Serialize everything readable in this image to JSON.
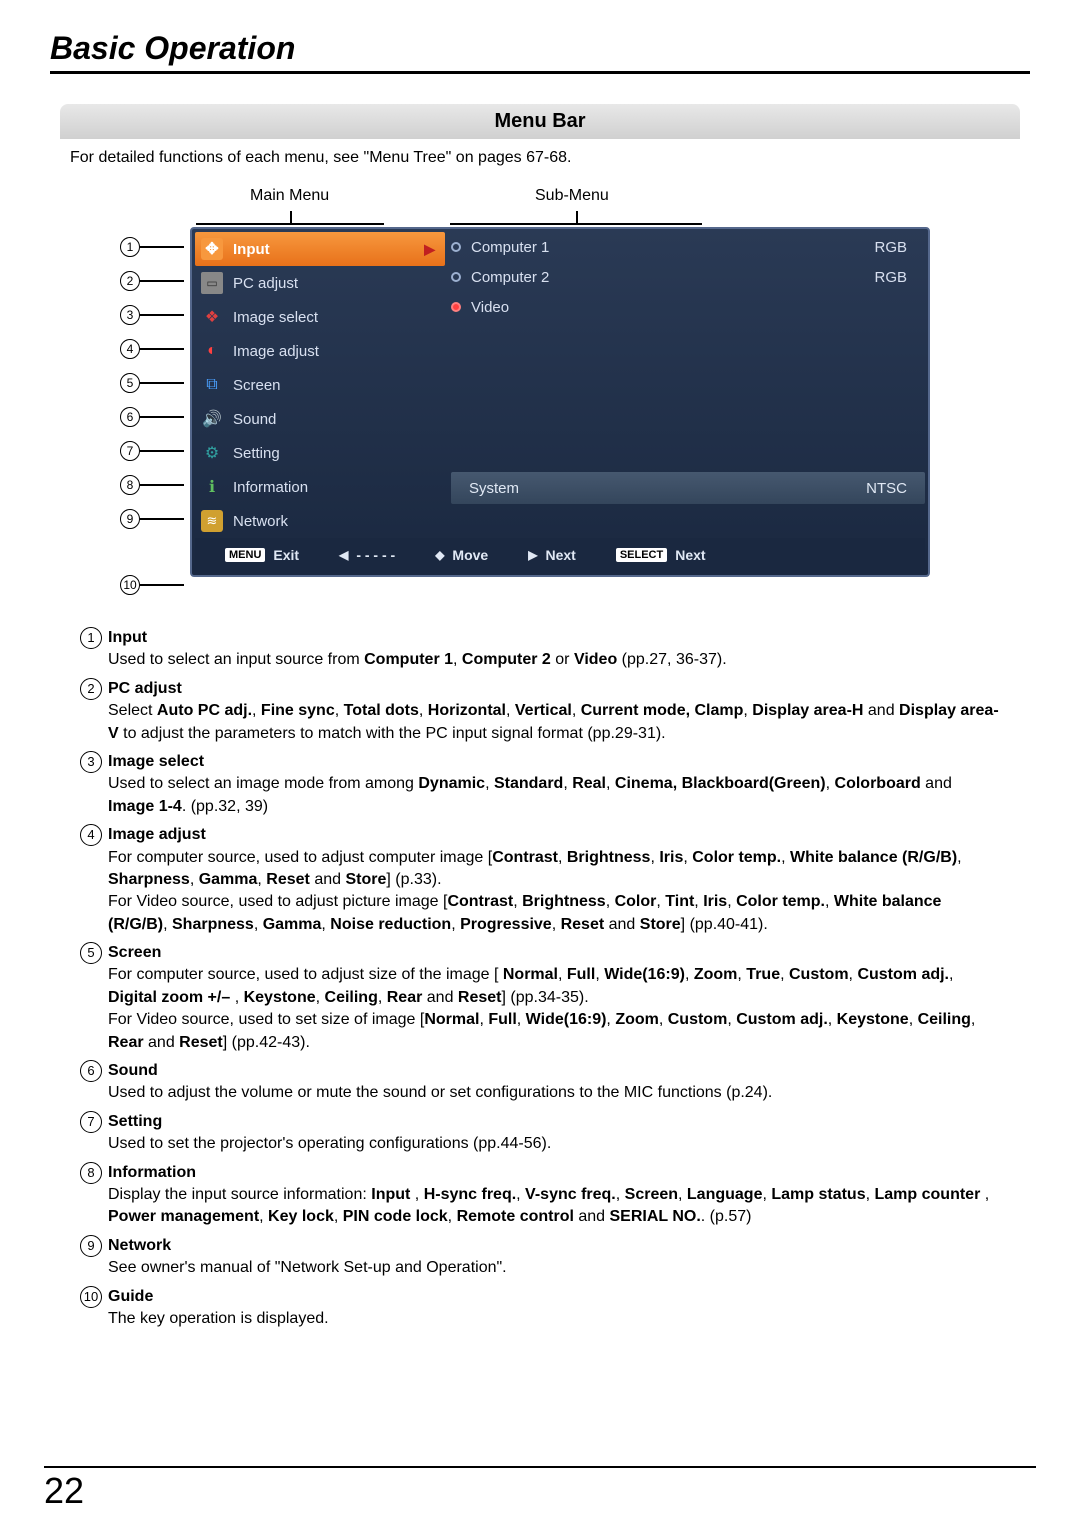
{
  "page": {
    "title": "Basic Operation",
    "section": "Menu Bar",
    "intro": "For detailed functions of each menu, see \"Menu Tree\" on pages 67-68.",
    "number": "22"
  },
  "columns": {
    "main": "Main Menu",
    "sub": "Sub-Menu"
  },
  "menu": {
    "items": [
      {
        "label": "Input",
        "iconClass": "icon-input",
        "glyph": "✥",
        "selected": true
      },
      {
        "label": "PC adjust",
        "iconClass": "icon-pc",
        "glyph": "▭"
      },
      {
        "label": "Image select",
        "iconClass": "icon-imgsel",
        "glyph": "❖"
      },
      {
        "label": "Image adjust",
        "iconClass": "icon-imgadj",
        "glyph": "◐"
      },
      {
        "label": "Screen",
        "iconClass": "icon-screen",
        "glyph": "⧉"
      },
      {
        "label": "Sound",
        "iconClass": "icon-sound",
        "glyph": "🔊"
      },
      {
        "label": "Setting",
        "iconClass": "icon-setting",
        "glyph": "⚙"
      },
      {
        "label": "Information",
        "iconClass": "icon-info",
        "glyph": "ℹ"
      },
      {
        "label": "Network",
        "iconClass": "icon-net",
        "glyph": "≋"
      }
    ]
  },
  "submenu": {
    "items": [
      {
        "label": "Computer 1",
        "value": "RGB",
        "active": false
      },
      {
        "label": "Computer 2",
        "value": "RGB",
        "active": false
      },
      {
        "label": "Video",
        "value": "",
        "active": true
      }
    ],
    "system": {
      "label": "System",
      "value": "NTSC"
    }
  },
  "guide": {
    "exit": "Exit",
    "menu_badge": "MENU",
    "back": "- - - - -",
    "move": "Move",
    "next": "Next",
    "select_badge": "SELECT",
    "select": "Next"
  },
  "callouts": [
    "①",
    "②",
    "③",
    "④",
    "⑤",
    "⑥",
    "⑦",
    "⑧",
    "⑨",
    "⑩"
  ],
  "defs": [
    {
      "num": "①",
      "title": "Input",
      "body": "Used to select an input source from <b>Computer 1</b>, <b>Computer 2</b> or <b>Video</b> (pp.27, 36-37)."
    },
    {
      "num": "②",
      "title": "PC adjust",
      "body": "Select <b>Auto PC adj.</b>, <b>Fine sync</b>, <b>Total dots</b>, <b>Horizontal</b>, <b>Vertical</b>, <b>Current mode, Clamp</b>, <b>Display area-H</b> and <b>Display area-V</b> to adjust the parameters to match with the PC input signal format (pp.29-31)."
    },
    {
      "num": "③",
      "title": "Image select",
      "body": "Used to select an image mode from among <b>Dynamic</b>, <b>Standard</b>, <b>Real</b>, <b>Cinema, Blackboard(Green)</b>, <b>Colorboard</b> and <b>Image 1-4</b>. (pp.32, 39)"
    },
    {
      "num": "④",
      "title": "Image adjust",
      "body": "For computer source, used to adjust computer image [<b>Contrast</b>, <b>Brightness</b>, <b>Iris</b>, <b>Color temp.</b>, <b>White balance (R/G/B)</b>, <b>Sharpness</b>, <b>Gamma</b>, <b>Reset</b> and <b>Store</b>] (p.33).<br>For Video source, used to adjust picture image [<b>Contrast</b>, <b>Brightness</b>, <b>Color</b>, <b>Tint</b>, <b>Iris</b>, <b>Color temp.</b>, <b>White balance (R/G/B)</b>, <b>Sharpness</b>, <b>Gamma</b>, <b>Noise reduction</b>, <b>Progressive</b>, <b>Reset</b> and <b>Store</b>] (pp.40-41)."
    },
    {
      "num": "⑤",
      "title": "Screen",
      "body": "For computer source, used to adjust size of the image [ <b>Normal</b>, <b>Full</b>, <b>Wide(16:9)</b>, <b>Zoom</b>, <b>True</b>, <b>Custom</b>, <b>Custom adj.</b>, <b>Digital zoom +/–</b> , <b>Keystone</b>, <b>Ceiling</b>, <b>Rear</b> and <b>Reset</b>] (pp.34-35).<br>For Video source, used to set size of image [<b>Normal</b>, <b>Full</b>, <b>Wide(16:9)</b>, <b>Zoom</b>, <b>Custom</b>, <b>Custom adj.</b>, <b>Keystone</b>, <b>Ceiling</b>, <b>Rear</b> and <b>Reset</b>] (pp.42-43)."
    },
    {
      "num": "⑥",
      "title": "Sound",
      "body": "Used to adjust the volume or mute the sound or set configurations to the MIC functions (p.24)."
    },
    {
      "num": "⑦",
      "title": "Setting",
      "body": "Used to set the projector's operating configurations (pp.44-56)."
    },
    {
      "num": "⑧",
      "title": "Information",
      "body": "Display the input source information: <b>Input</b> , <b>H-sync freq.</b>, <b>V-sync freq.</b>, <b>Screen</b>, <b>Language</b>, <b>Lamp status</b>, <b>Lamp counter</b> , <b>Power management</b>, <b>Key lock</b>, <b>PIN code lock</b>, <b>Remote control</b> and <b>SERIAL NO.</b>. (p.57)"
    },
    {
      "num": "⑨",
      "title": "Network",
      "body": "See owner's manual of \"Network Set-up and Operation\"."
    },
    {
      "num": "⑩",
      "title": "Guide",
      "body": "The key operation is displayed."
    }
  ]
}
